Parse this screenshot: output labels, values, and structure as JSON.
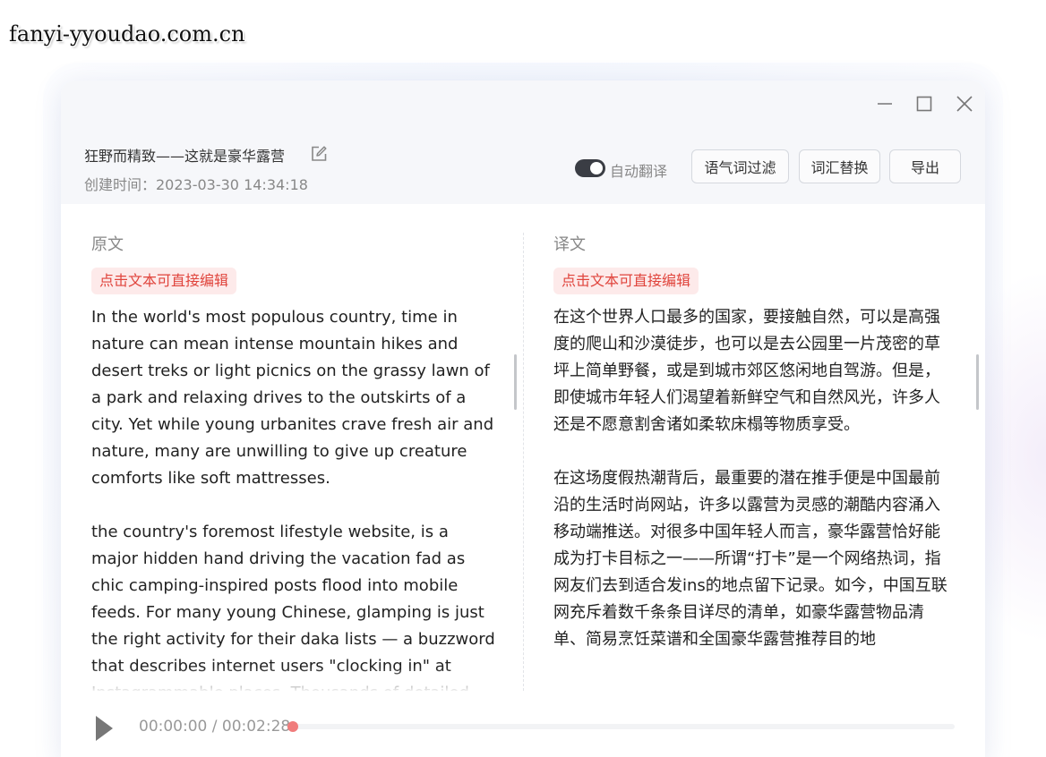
{
  "watermark": "fanyi-yyoudao.com.cn",
  "window": {
    "controls": {
      "minimize": "minimize-icon",
      "maximize": "maximize-icon",
      "close": "close-icon"
    }
  },
  "header": {
    "title": "狂野而精致——这就是豪华露营",
    "created": "创建时间：2023-03-30 14:34:18",
    "auto_translate_label": "自动翻译",
    "auto_translate_on": true,
    "buttons": {
      "filter": "语气词过滤",
      "replace": "词汇替换",
      "export": "导出"
    }
  },
  "source": {
    "heading": "原文",
    "edit_hint": "点击文本可直接编辑",
    "paragraphs": [
      "In the world's most populous country, time in nature can mean intense mountain hikes and desert treks or light picnics on the grassy lawn of a park and relaxing drives to the outskirts of a city. Yet while young urbanites crave fresh air and nature, many are unwilling to give up creature comforts like soft mattresses.",
      "the country's foremost lifestyle website, is a major hidden hand driving the vacation fad as chic camping-inspired posts flood into mobile feeds. For many young Chinese, glamping is just the right activity for their daka lists — a buzzword that describes internet users \"clocking in\" at Instagrammable places. Thousands of detailed lists"
    ]
  },
  "translation": {
    "heading": "译文",
    "edit_hint": "点击文本可直接编辑",
    "paragraphs": [
      "在这个世界人口最多的国家，要接触自然，可以是高强度的爬山和沙漠徒步，也可以是去公园里一片茂密的草坪上简单野餐，或是到城市郊区悠闲地自驾游。但是，即使城市年轻人们渴望着新鲜空气和自然风光，许多人还是不愿意割舍诸如柔软床榻等物质享受。",
      "在这场度假热潮背后，最重要的潜在推手便是中国最前沿的生活时尚网站，许多以露营为灵感的潮酷内容涌入移动端推送。对很多中国年轻人而言，豪华露营恰好能成为打卡目标之一——所谓“打卡”是一个网络热词，指网友们去到适合发ins的地点留下记录。如今，中国互联网充斥着数千条条目详尽的清单，如豪华露营物品清单、简易烹饪菜谱和全国豪华露营推荐目的地"
    ]
  },
  "player": {
    "time": "00:00:00 / 00:02:28",
    "progress": 0
  },
  "colors": {
    "accent_red": "#e0443c",
    "pill_bg": "#fdeaea",
    "toggle_on": "#3a3d44",
    "progress_dot": "#f07c7c"
  }
}
